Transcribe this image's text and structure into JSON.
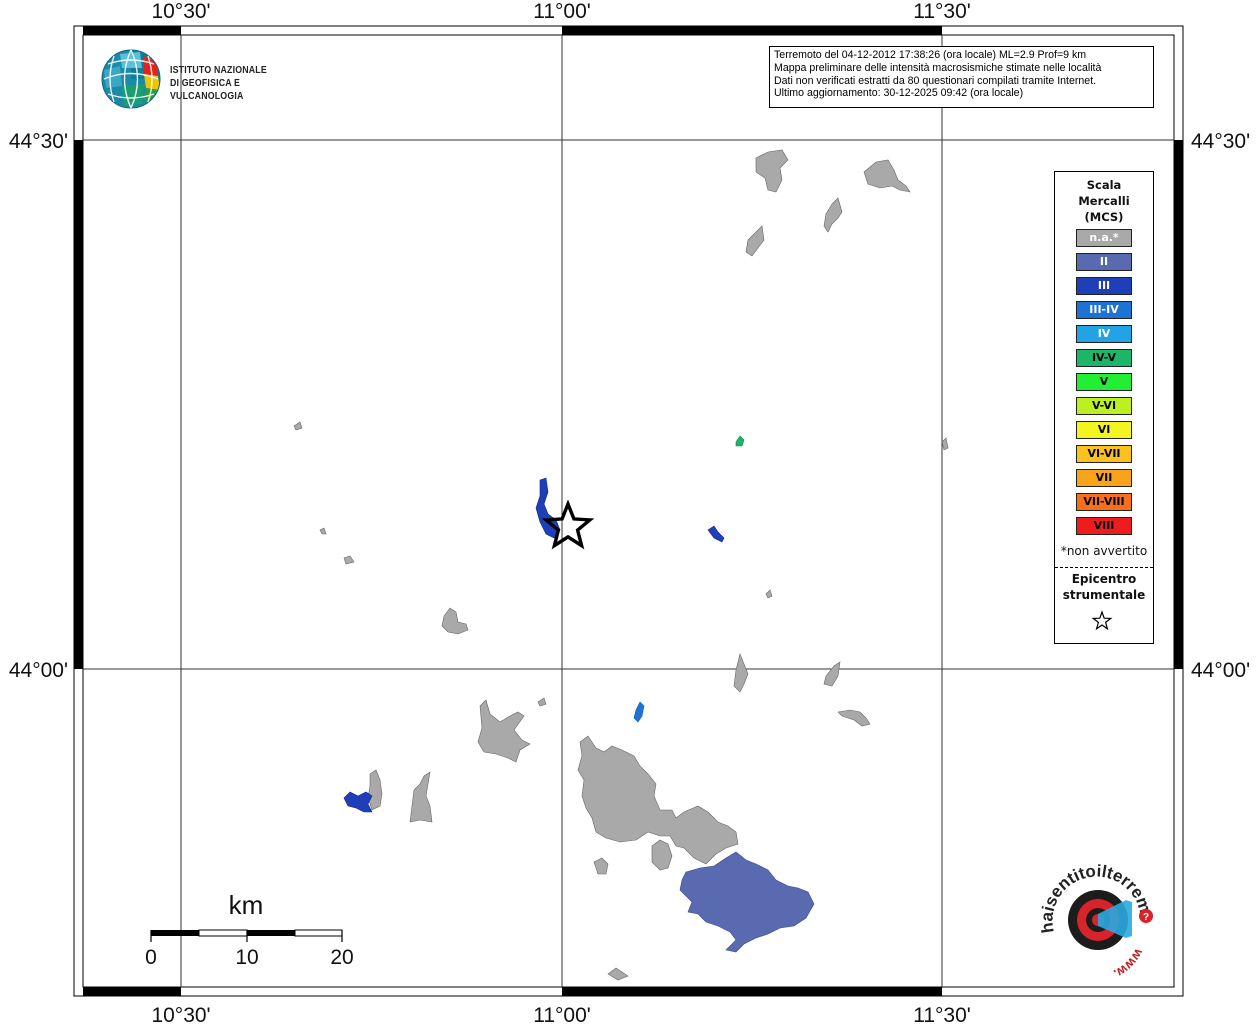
{
  "map": {
    "lon_labels": [
      "10°30'",
      "11°00'",
      "11°30'"
    ],
    "lat_labels": [
      "44°30'",
      "44°00'"
    ],
    "scale_bar": {
      "unit": "km",
      "labels": [
        "0",
        "10",
        "20"
      ]
    }
  },
  "info_box": {
    "line1": "Terremoto del 04-12-2012 17:38:26 (ora locale) ML=2.9 Prof=9 km",
    "line2": "Mappa preliminare delle intensità macrosismiche stimate nelle località",
    "line3": "Dati non verificati estratti da 80 questionari compilati tramite Internet.",
    "line4": "Ultimo aggiornamento: 30-12-2025 09:42 (ora locale)"
  },
  "logo": {
    "line1": "ISTITUTO NAZIONALE",
    "line2": "DI GEOFISICA E VULCANOLOGIA"
  },
  "legend": {
    "title_line1": "Scala",
    "title_line2": "Mercalli",
    "title_line3": "(MCS)",
    "classes": [
      {
        "label": "n.a.*",
        "color": "#a9a9a9",
        "text_color": "#ffffff"
      },
      {
        "label": "II",
        "color": "#5a6ab0",
        "text_color": "#ffffff"
      },
      {
        "label": "III",
        "color": "#1f3fb8",
        "text_color": "#ffffff"
      },
      {
        "label": "III-IV",
        "color": "#1e73d2",
        "text_color": "#ffffff"
      },
      {
        "label": "IV",
        "color": "#22a3e6",
        "text_color": "#ffffff"
      },
      {
        "label": "IV-V",
        "color": "#1cb56a",
        "text_color": "#000000"
      },
      {
        "label": "V",
        "color": "#22ee33",
        "text_color": "#000000"
      },
      {
        "label": "V-VI",
        "color": "#bdf020",
        "text_color": "#000000"
      },
      {
        "label": "VI",
        "color": "#f4f421",
        "text_color": "#000000"
      },
      {
        "label": "VI-VII",
        "color": "#f9c21e",
        "text_color": "#000000"
      },
      {
        "label": "VII",
        "color": "#f9a31c",
        "text_color": "#000000"
      },
      {
        "label": "VII-VIII",
        "color": "#f76f1c",
        "text_color": "#000000"
      },
      {
        "label": "VIII",
        "color": "#ee1c1c",
        "text_color": "#000000"
      }
    ],
    "note": "*non avvertito",
    "epicenter_line1": "Epicentro",
    "epicenter_line2": "strumentale"
  },
  "watermark": {
    "text": "haisentitoilterremoto.it",
    "url": "www."
  },
  "colors": {
    "na": "#a9a9a9",
    "II": "#5a6ab0",
    "III": "#1f3fb8",
    "III-IV": "#1e73d2",
    "IV-V": "#1cb56a"
  }
}
